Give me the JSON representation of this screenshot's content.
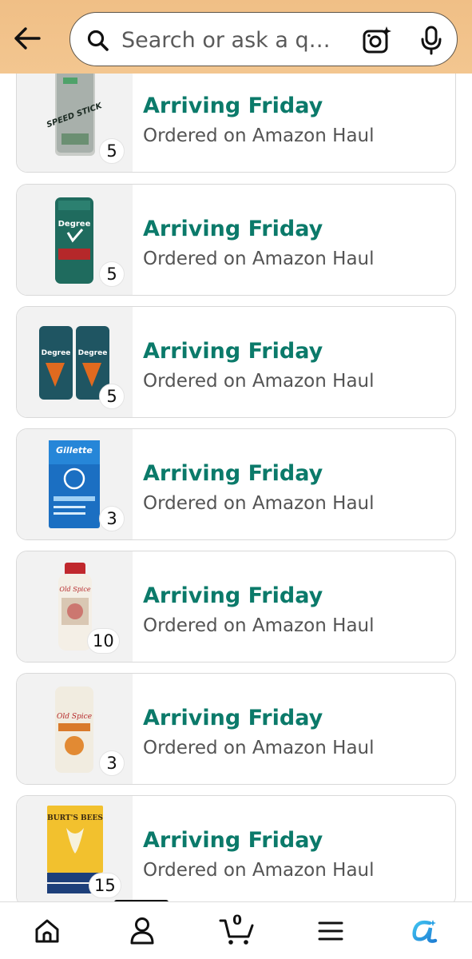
{
  "header": {
    "search": {
      "placeholder": "Search or ask a q…"
    }
  },
  "orders": [
    {
      "status": "Arriving Friday",
      "source": "Ordered on Amazon Haul",
      "quantity": "5",
      "product": "Speed Stick deodorant",
      "label": "SPEED STICK"
    },
    {
      "status": "Arriving Friday",
      "source": "Ordered on Amazon Haul",
      "quantity": "5",
      "product": "Degree Sport deodorant",
      "label": "Degree"
    },
    {
      "status": "Arriving Friday",
      "source": "Ordered on Amazon Haul",
      "quantity": "5",
      "product": "Degree 72H deodorant twin pack",
      "label": "Degree"
    },
    {
      "status": "Arriving Friday",
      "source": "Ordered on Amazon Haul",
      "quantity": "3",
      "product": "Gillette Clinical deodorant",
      "label": "Gillette"
    },
    {
      "status": "Arriving Friday",
      "source": "Ordered on Amazon Haul",
      "quantity": "10",
      "product": "Old Spice body wash",
      "label": "Old Spice"
    },
    {
      "status": "Arriving Friday",
      "source": "Ordered on Amazon Haul",
      "quantity": "3",
      "product": "Old Spice Pumpkin deodorant",
      "label": "Old Spice"
    },
    {
      "status": "Arriving Friday",
      "source": "Ordered on Amazon Haul",
      "quantity": "15",
      "product": "Burt's Bees lip balm",
      "label": "BURT'S BEES"
    }
  ],
  "bottom_nav": {
    "cart_count": "0",
    "items": [
      "home-icon",
      "account-icon",
      "cart-icon",
      "menu-icon",
      "rufus-icon"
    ]
  },
  "colors": {
    "header_bg": "#f2c48c",
    "status_green": "#0b7a6a",
    "rufus_blue": "#2aa3e6"
  }
}
